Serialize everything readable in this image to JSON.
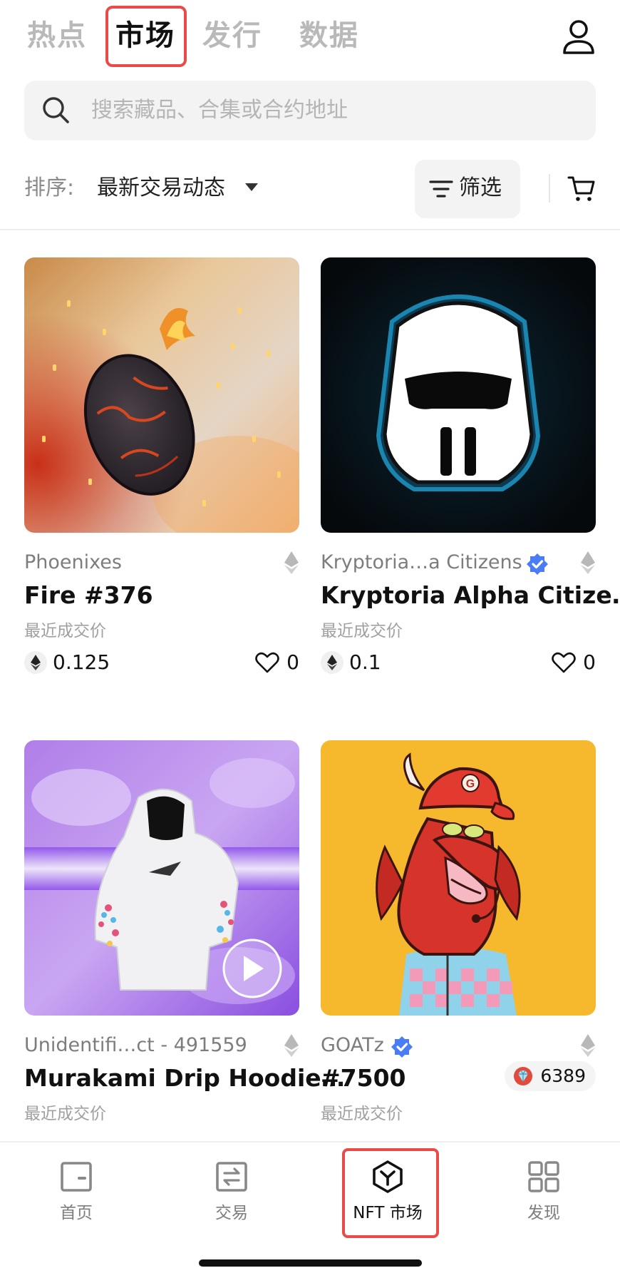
{
  "top_tabs": [
    {
      "label": "热点",
      "active": false
    },
    {
      "label": "市场",
      "active": true
    },
    {
      "label": "发行",
      "active": false
    },
    {
      "label": "数据",
      "active": false
    }
  ],
  "search": {
    "placeholder": "搜索藏品、合集或合约地址"
  },
  "sort": {
    "label": "排序:",
    "value": "最新交易动态"
  },
  "filter": {
    "label": "筛选"
  },
  "cards": [
    {
      "collection": "Phoenixes",
      "verified": false,
      "title": "Fire #376",
      "price_label": "最近成交价",
      "price": "0.125",
      "likes": "0"
    },
    {
      "collection": "Kryptoria…a Citizens",
      "verified": true,
      "title": "Kryptoria Alpha Citize…",
      "price_label": "最近成交价",
      "price": "0.1",
      "likes": "0"
    },
    {
      "collection": "Unidentifi…ct - 491559",
      "verified": false,
      "title": "Murakami Drip Hoodie…",
      "price_label": "最近成交价"
    },
    {
      "collection": "GOATz",
      "verified": true,
      "title": "#7500",
      "price_label": "最近成交价",
      "rarity": "6389"
    }
  ],
  "bottom_nav": [
    {
      "label": "首页",
      "icon": "wallet-icon",
      "active": false
    },
    {
      "label": "交易",
      "icon": "swap-icon",
      "active": false
    },
    {
      "label": "NFT 市场",
      "icon": "nft-market-icon",
      "active": true
    },
    {
      "label": "发现",
      "icon": "grid-icon",
      "active": false
    }
  ],
  "colors": {
    "highlight": "#e94b4b",
    "verified": "#4a7cf6",
    "muted": "#b9b9b9"
  }
}
